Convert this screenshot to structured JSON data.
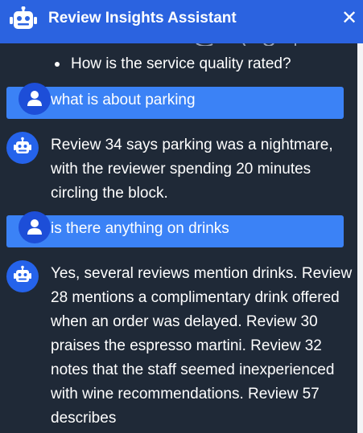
{
  "header": {
    "title": "Review Insights Assistant",
    "close_symbol": "✕",
    "bot_icon": "robot-icon",
    "close_icon": "close-icon"
  },
  "chat": {
    "bullet_item": "How is the service quality rated?",
    "messages": [
      {
        "role": "user",
        "text": "what is about parking",
        "icon": "user-icon"
      },
      {
        "role": "assistant",
        "text": "Review 34 says parking was a nightmare, with the reviewer spending 20 minutes circling the block.",
        "icon": "robot-icon"
      },
      {
        "role": "user",
        "text": "is there anything on drinks",
        "icon": "user-icon"
      },
      {
        "role": "assistant",
        "text": "Yes, several reviews mention drinks. Review 28 mentions a complimentary drink offered when an order was delayed. Review 30 praises the espresso martini. Review 32 notes that the staff seemed inexperienced with wine recommendations. Review 57 describes",
        "icon": "robot-icon"
      }
    ]
  },
  "colors": {
    "header_bg": "#2b63e0",
    "chat_bg": "#1f2937",
    "user_bubble": "#3b82f6",
    "avatar_bg": "#2563eb"
  }
}
